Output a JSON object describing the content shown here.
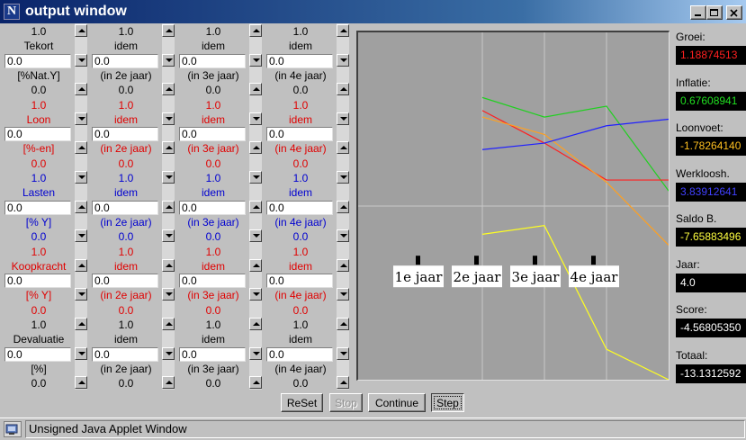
{
  "window": {
    "title": "output window",
    "app_icon_letter": "N",
    "status_text": "Unsigned Java Applet Window"
  },
  "columns": [
    {
      "rows": [
        {
          "type": "text",
          "color": "black",
          "text": "1.0"
        },
        {
          "type": "text",
          "color": "black",
          "text": "Tekort"
        },
        {
          "type": "input",
          "value": "0.0"
        },
        {
          "type": "text",
          "color": "black",
          "text": "[%Nat.Y]"
        },
        {
          "type": "text",
          "color": "black",
          "text": "0.0"
        },
        {
          "type": "text",
          "color": "red",
          "text": "1.0"
        },
        {
          "type": "text",
          "color": "red",
          "text": "Loon"
        },
        {
          "type": "input",
          "value": "0.0"
        },
        {
          "type": "text",
          "color": "red",
          "text": "[%-en]"
        },
        {
          "type": "text",
          "color": "red",
          "text": "0.0"
        },
        {
          "type": "text",
          "color": "blue",
          "text": "1.0"
        },
        {
          "type": "text",
          "color": "blue",
          "text": "Lasten"
        },
        {
          "type": "input",
          "value": "0.0"
        },
        {
          "type": "text",
          "color": "blue",
          "text": "[% Y]"
        },
        {
          "type": "text",
          "color": "blue",
          "text": "0.0"
        },
        {
          "type": "text",
          "color": "red",
          "text": "1.0"
        },
        {
          "type": "text",
          "color": "red",
          "text": "Koopkracht"
        },
        {
          "type": "input",
          "value": "0.0"
        },
        {
          "type": "text",
          "color": "red",
          "text": "[% Y]"
        },
        {
          "type": "text",
          "color": "red",
          "text": "0.0"
        },
        {
          "type": "text",
          "color": "black",
          "text": "1.0"
        },
        {
          "type": "text",
          "color": "black",
          "text": "Devaluatie"
        },
        {
          "type": "input",
          "value": "0.0"
        },
        {
          "type": "text",
          "color": "black",
          "text": "[%]"
        },
        {
          "type": "text",
          "color": "black",
          "text": "0.0"
        }
      ]
    },
    {
      "rows": [
        {
          "type": "text",
          "color": "black",
          "text": "1.0"
        },
        {
          "type": "text",
          "color": "black",
          "text": "idem"
        },
        {
          "type": "input",
          "value": "0.0"
        },
        {
          "type": "text",
          "color": "black",
          "text": "(in 2e jaar)"
        },
        {
          "type": "text",
          "color": "black",
          "text": "0.0"
        },
        {
          "type": "text",
          "color": "red",
          "text": "1.0"
        },
        {
          "type": "text",
          "color": "red",
          "text": "idem"
        },
        {
          "type": "input",
          "value": "0.0"
        },
        {
          "type": "text",
          "color": "red",
          "text": "(in 2e jaar)"
        },
        {
          "type": "text",
          "color": "red",
          "text": "0.0"
        },
        {
          "type": "text",
          "color": "blue",
          "text": "1.0"
        },
        {
          "type": "text",
          "color": "blue",
          "text": "idem"
        },
        {
          "type": "input",
          "value": "0.0"
        },
        {
          "type": "text",
          "color": "blue",
          "text": "(in 2e jaar)"
        },
        {
          "type": "text",
          "color": "blue",
          "text": "0.0"
        },
        {
          "type": "text",
          "color": "red",
          "text": "1.0"
        },
        {
          "type": "text",
          "color": "red",
          "text": "idem"
        },
        {
          "type": "input",
          "value": "0.0"
        },
        {
          "type": "text",
          "color": "red",
          "text": "(in 2e jaar)"
        },
        {
          "type": "text",
          "color": "red",
          "text": "0.0"
        },
        {
          "type": "text",
          "color": "black",
          "text": "1.0"
        },
        {
          "type": "text",
          "color": "black",
          "text": "idem"
        },
        {
          "type": "input",
          "value": "0.0"
        },
        {
          "type": "text",
          "color": "black",
          "text": "(in 2e jaar)"
        },
        {
          "type": "text",
          "color": "black",
          "text": "0.0"
        }
      ]
    },
    {
      "rows": [
        {
          "type": "text",
          "color": "black",
          "text": "1.0"
        },
        {
          "type": "text",
          "color": "black",
          "text": "idem"
        },
        {
          "type": "input",
          "value": "0.0"
        },
        {
          "type": "text",
          "color": "black",
          "text": "(in 3e jaar)"
        },
        {
          "type": "text",
          "color": "black",
          "text": "0.0"
        },
        {
          "type": "text",
          "color": "red",
          "text": "1.0"
        },
        {
          "type": "text",
          "color": "red",
          "text": "idem"
        },
        {
          "type": "input",
          "value": "0.0"
        },
        {
          "type": "text",
          "color": "red",
          "text": "(in 3e jaar)"
        },
        {
          "type": "text",
          "color": "red",
          "text": "0.0"
        },
        {
          "type": "text",
          "color": "blue",
          "text": "1.0"
        },
        {
          "type": "text",
          "color": "blue",
          "text": "idem"
        },
        {
          "type": "input",
          "value": "0.0"
        },
        {
          "type": "text",
          "color": "blue",
          "text": "(in 3e jaar)"
        },
        {
          "type": "text",
          "color": "blue",
          "text": "0.0"
        },
        {
          "type": "text",
          "color": "red",
          "text": "1.0"
        },
        {
          "type": "text",
          "color": "red",
          "text": "idem"
        },
        {
          "type": "input",
          "value": "0.0"
        },
        {
          "type": "text",
          "color": "red",
          "text": "(in 3e jaar)"
        },
        {
          "type": "text",
          "color": "red",
          "text": "0.0"
        },
        {
          "type": "text",
          "color": "black",
          "text": "1.0"
        },
        {
          "type": "text",
          "color": "black",
          "text": "idem"
        },
        {
          "type": "input",
          "value": "0.0"
        },
        {
          "type": "text",
          "color": "black",
          "text": "(in 3e jaar)"
        },
        {
          "type": "text",
          "color": "black",
          "text": "0.0"
        }
      ]
    },
    {
      "rows": [
        {
          "type": "text",
          "color": "black",
          "text": "1.0"
        },
        {
          "type": "text",
          "color": "black",
          "text": "idem"
        },
        {
          "type": "input",
          "value": "0.0"
        },
        {
          "type": "text",
          "color": "black",
          "text": "(in 4e jaar)"
        },
        {
          "type": "text",
          "color": "black",
          "text": "0.0"
        },
        {
          "type": "text",
          "color": "red",
          "text": "1.0"
        },
        {
          "type": "text",
          "color": "red",
          "text": "idem"
        },
        {
          "type": "input",
          "value": "0.0"
        },
        {
          "type": "text",
          "color": "red",
          "text": "(in 4e jaar)"
        },
        {
          "type": "text",
          "color": "red",
          "text": "0.0"
        },
        {
          "type": "text",
          "color": "blue",
          "text": "1.0"
        },
        {
          "type": "text",
          "color": "blue",
          "text": "idem"
        },
        {
          "type": "input",
          "value": "0.0"
        },
        {
          "type": "text",
          "color": "blue",
          "text": "(in 4e jaar)"
        },
        {
          "type": "text",
          "color": "blue",
          "text": "0.0"
        },
        {
          "type": "text",
          "color": "red",
          "text": "1.0"
        },
        {
          "type": "text",
          "color": "red",
          "text": "idem"
        },
        {
          "type": "input",
          "value": "0.0"
        },
        {
          "type": "text",
          "color": "red",
          "text": "(in 4e jaar)"
        },
        {
          "type": "text",
          "color": "red",
          "text": "0.0"
        },
        {
          "type": "text",
          "color": "black",
          "text": "1.0"
        },
        {
          "type": "text",
          "color": "black",
          "text": "idem"
        },
        {
          "type": "input",
          "value": "0.0"
        },
        {
          "type": "text",
          "color": "black",
          "text": "(in 4e jaar)"
        },
        {
          "type": "text",
          "color": "black",
          "text": "0.0"
        }
      ]
    }
  ],
  "indicators": [
    {
      "label": "Groei:",
      "value": "1.18874513",
      "color": "#ff2020"
    },
    {
      "label": "Inflatie:",
      "value": "0.67608941",
      "color": "#20e020"
    },
    {
      "label": "Loonvoet:",
      "value": "-1.78264140",
      "color": "#ffc020"
    },
    {
      "label": "Werkloosh.",
      "value": "3.83912641",
      "color": "#4040ff"
    },
    {
      "label": "Saldo B.",
      "value": "-7.65883496",
      "color": "#ffff40"
    },
    {
      "label": "Jaar:",
      "value": "4.0",
      "color": "#ffffff"
    },
    {
      "label": "Score:",
      "value": "-4.56805350",
      "color": "#ffffff"
    },
    {
      "label": "Totaal:",
      "value": "-13.1312592",
      "color": "#ffffff"
    }
  ],
  "buttons": [
    {
      "label": "ReSet",
      "state": "normal"
    },
    {
      "label": "Stop",
      "state": "disabled"
    },
    {
      "label": "Continue",
      "state": "normal"
    },
    {
      "label": "Step",
      "state": "pressed"
    }
  ],
  "chart_data": {
    "type": "line",
    "categories": [
      "1e jaar",
      "2e jaar",
      "3e jaar",
      "4e jaar"
    ],
    "x": [
      1,
      2,
      3,
      4,
      5
    ],
    "xlim": [
      0,
      5
    ],
    "ylim": [
      -8,
      8
    ],
    "grid": true,
    "colors": {
      "background": "#a0a0a0",
      "grid": "#c8c8c8"
    },
    "series": [
      {
        "color": "#20d020",
        "values": [
          5.0,
          4.1,
          4.6,
          0.7
        ]
      },
      {
        "color": "#ff2020",
        "values": [
          4.4,
          2.9,
          1.2,
          1.2
        ]
      },
      {
        "color": "#ffa020",
        "values": [
          4.1,
          3.3,
          1.1,
          -1.8
        ]
      },
      {
        "color": "#2020ff",
        "values": [
          2.6,
          2.9,
          3.7,
          4.0
        ]
      },
      {
        "color": "#ffff20",
        "values": [
          -1.3,
          -0.9,
          -6.6,
          -8.0
        ]
      }
    ]
  }
}
